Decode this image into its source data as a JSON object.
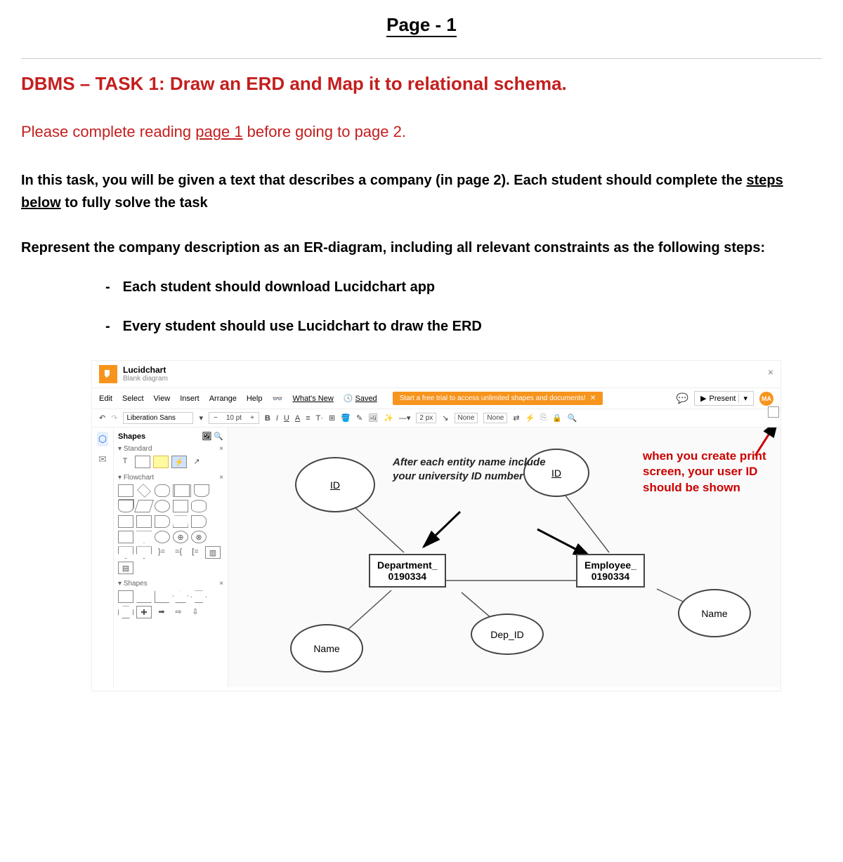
{
  "document": {
    "page_label": "Page - 1",
    "task_title": "DBMS – TASK 1: Draw an ERD and Map it to relational schema.",
    "instruction_prefix": "Please complete reading ",
    "instruction_link": "page 1",
    "instruction_suffix": " before going to page 2.",
    "body1_a": "In this task, you will be given a text that describes a company (in page 2). Each student should complete the ",
    "body1_u": "steps below",
    "body1_b": " to fully solve the task",
    "steps_intro": "Represent the company description as an ER-diagram, including all relevant constraints as the following steps:",
    "step1": "Each student should download Lucidchart app",
    "step2": "Every student should use Lucidchart to draw the ERD"
  },
  "app": {
    "name": "Lucidchart",
    "subtitle": "Blank diagram",
    "menus": [
      "Edit",
      "Select",
      "View",
      "Insert",
      "Arrange",
      "Help"
    ],
    "whats_new": "What's New",
    "saved": "Saved",
    "trial_banner": "Start a free trial to access unlimited shapes and documents!",
    "present": "Present",
    "avatar": "MA",
    "font": "Liberation Sans",
    "font_size": "10 pt",
    "stroke_width": "2 px",
    "arrow_left": "None",
    "arrow_right": "None",
    "shapes_title": "Shapes",
    "groups": {
      "standard": "Standard",
      "flowchart": "Flowchart",
      "shapes": "Shapes"
    }
  },
  "erd": {
    "id1": "ID",
    "id2": "ID",
    "dept": "Department_0190334",
    "emp": "Employee_0190334",
    "depid": "Dep_ID",
    "name1": "Name",
    "name2": "Name",
    "note_title": "After each entity name include your university ID number",
    "red_note": "when you create print screen, your user ID should be shown"
  }
}
